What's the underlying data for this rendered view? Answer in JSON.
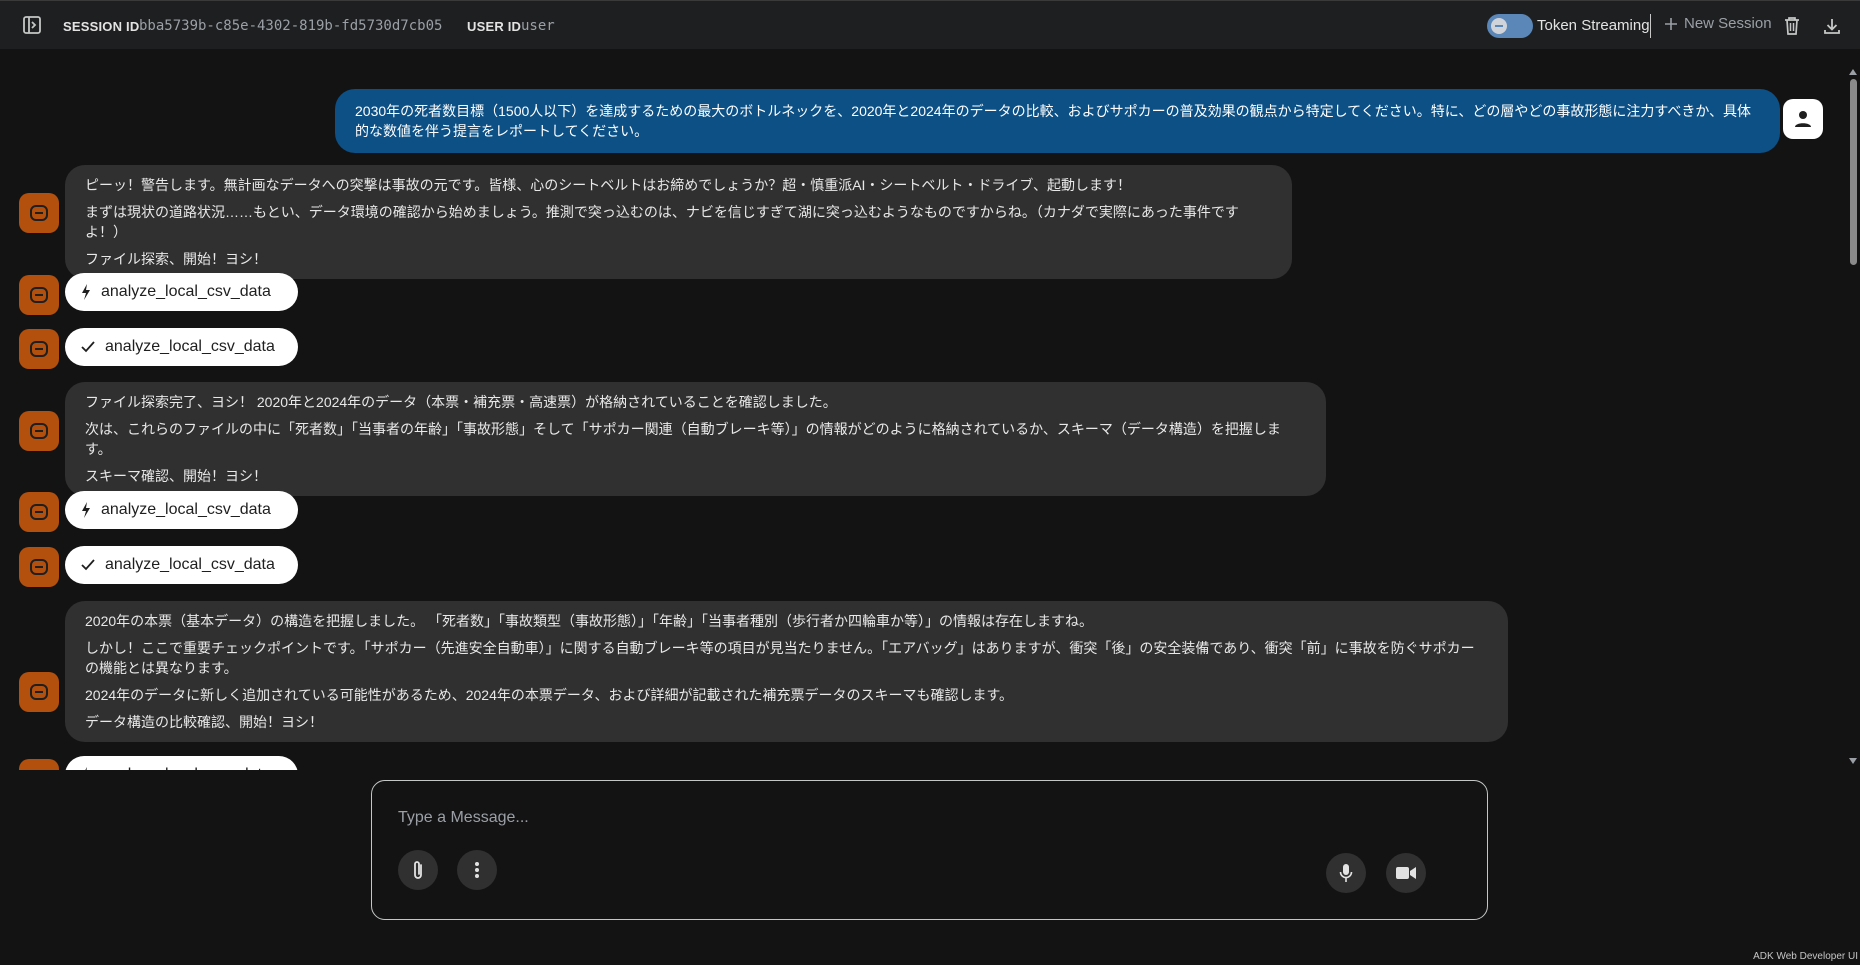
{
  "header": {
    "session_label": "SESSION ID",
    "session_id": "bba5739b-c85e-4302-819b-fd5730d7cb05",
    "user_label": "USER ID",
    "user_id": "user",
    "token_streaming_label": "Token Streaming",
    "new_session_label": "New Session"
  },
  "messages": {
    "user_prompt": "2030年の死者数目標（1500人以下）を達成するための最大のボトルネックを、2020年と2024年のデータの比較、およびサポカーの普及効果の観点から特定してください。特に、どの層やどの事故形態に注力すべきか、具体的な数値を伴う提言をレポートしてください。",
    "bot1": [
      "ピーッ！警告します。無計画なデータへの突撃は事故の元です。皆様、心のシートベルトはお締めでしょうか？超・慎重派AI・シートベルト・ドライブ、起動します！",
      "まずは現状の道路状況……もとい、データ環境の確認から始めましょう。推測で突っ込むのは、ナビを信じすぎて湖に突っ込むようなものですからね。（カナダで実際にあった事件ですよ！）",
      "ファイル探索、開始！ヨシ！"
    ],
    "bot2": [
      "ファイル探索完了、ヨシ！ 2020年と2024年のデータ（本票・補充票・高速票）が格納されていることを確認しました。",
      "次は、これらのファイルの中に「死者数」「当事者の年齢」「事故形態」そして「サポカー関連（自動ブレーキ等）」の情報がどのように格納されているか、スキーマ（データ構造）を把握します。",
      "スキーマ確認、開始！ヨシ！"
    ],
    "bot3": [
      "2020年の本票（基本データ）の構造を把握しました。 「死者数」「事故類型（事故形態）」「年齢」「当事者種別（歩行者か四輪車か等）」の情報は存在しますね。",
      "しかし！ここで重要チェックポイントです。「サポカー（先進安全自動車）」に関する自動ブレーキ等の項目が見当たりません。「エアバッグ」はありますが、衝突「後」の安全装備であり、衝突「前」に事故を防ぐサポカーの機能とは異なります。",
      "2024年のデータに新しく追加されている可能性があるため、2024年の本票データ、および詳細が記載された補充票データのスキーマも確認します。",
      "データ構造の比較確認、開始！ヨシ！"
    ],
    "tool_name": "analyze_local_csv_data"
  },
  "input": {
    "placeholder": "Type a Message..."
  },
  "footer": "ADK Web Developer UI",
  "icons": {
    "call": "bolt-icon",
    "result": "check-icon"
  },
  "colors": {
    "user_bubble": "#0c5085",
    "bot_avatar": "#b3500e",
    "bot_bubble": "#303030"
  }
}
